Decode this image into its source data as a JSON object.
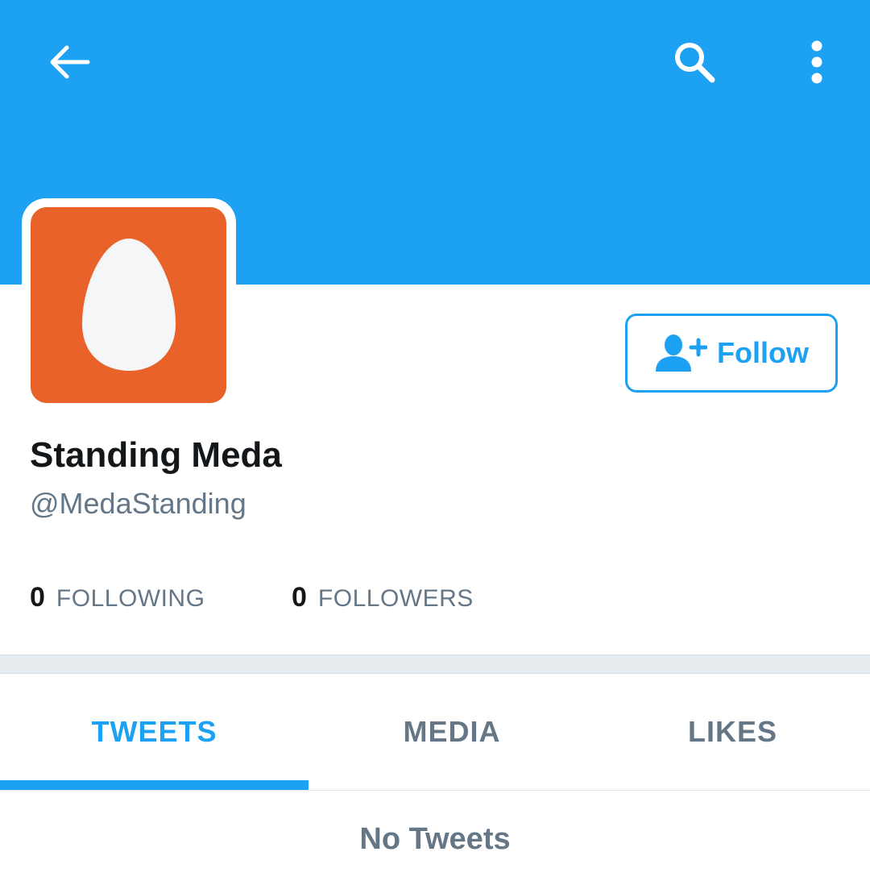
{
  "header": {
    "back_icon": "arrow-left-icon",
    "search_icon": "search-icon",
    "more_icon": "more-vertical-icon",
    "background_color": "#1da1f2"
  },
  "profile": {
    "avatar_icon": "egg-icon",
    "avatar_color": "#e8622a",
    "display_name": "Standing Meda",
    "handle": "@MedaStanding",
    "follow_button": {
      "icon": "add-user-icon",
      "label": "Follow"
    }
  },
  "stats": {
    "following": {
      "count": "0",
      "label": "FOLLOWING"
    },
    "followers": {
      "count": "0",
      "label": "FOLLOWERS"
    }
  },
  "tabs": [
    {
      "label": "TWEETS",
      "active": true
    },
    {
      "label": "MEDIA",
      "active": false
    },
    {
      "label": "LIKES",
      "active": false
    }
  ],
  "content": {
    "empty_message": "No Tweets"
  },
  "colors": {
    "accent": "#1da1f2",
    "text_primary": "#14171a",
    "text_secondary": "#657786"
  }
}
